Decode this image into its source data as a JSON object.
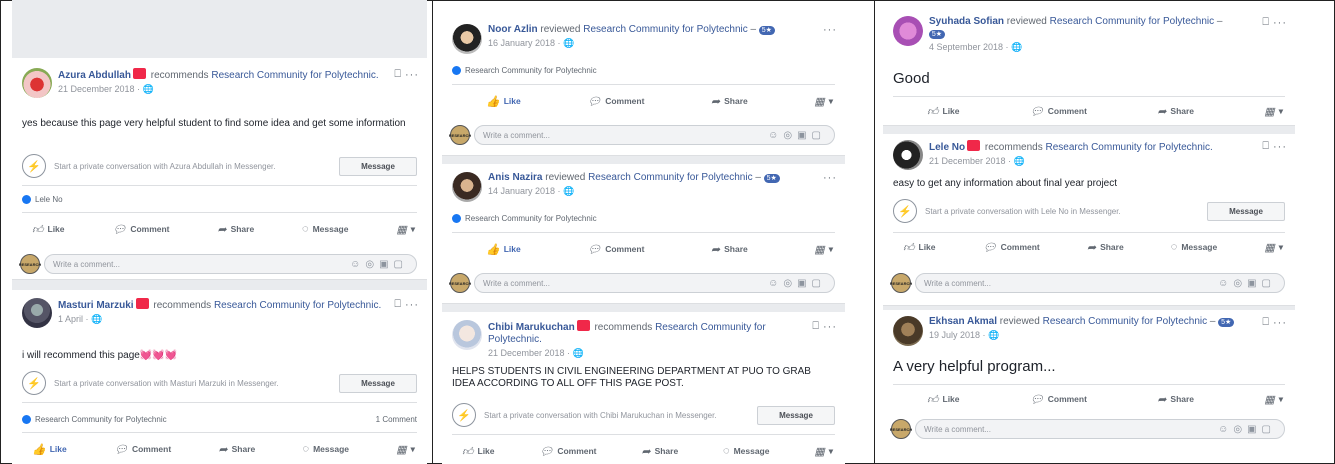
{
  "common": {
    "page_name": "Research Community for Polytechnic",
    "recommends": "recommends",
    "reviewed": "reviewed",
    "dash": "–",
    "badge": "5★",
    "like": "Like",
    "comment": "Comment",
    "share": "Share",
    "message": "Message",
    "write_comment": "Write a comment...",
    "message_button": "Message",
    "page_avatar": "RESEARCH",
    "colors": {
      "link": "#385898",
      "like_active": "#4267b2",
      "flag": "#f02849",
      "badge": "#4267b2"
    }
  },
  "posts": {
    "azura": {
      "name": "Azura Abdullah",
      "page": "Research Community for Polytechnic.",
      "date": "21 December 2018 · 🌐",
      "text": "yes because this page very helpful student to find some idea and get some information",
      "pm_text": "Start a private conversation with Azura Abdullah in Messenger.",
      "liker": "Lele No"
    },
    "masturi": {
      "name": "Masturi Marzuki",
      "page": "Research Community for Polytechnic.",
      "date": "1 April · 🌐",
      "text": "i will recommend this page💓💓💓",
      "pm_text": "Start a private conversation with Masturi Marzuki in Messenger.",
      "rec": "Research Community for Polytechnic",
      "comment_count": "1 Comment"
    },
    "noor": {
      "name": "Noor Azlin",
      "page": "Research Community for Polytechnic",
      "date": "16 January 2018 · 🌐",
      "rec": "Research Community for Polytechnic"
    },
    "anis": {
      "name": "Anis Nazira",
      "page": "Research Community for Polytechnic",
      "date": "14 January 2018 · 🌐",
      "rec": "Research Community for Polytechnic"
    },
    "chibi": {
      "name": "Chibi Marukuchan",
      "page": "Research Community for Polytechnic.",
      "date": "21 December 2018 · 🌐",
      "text": "HELPS STUDENTS IN CIVIL ENGINEERING DEPARTMENT AT PUO TO GRAB IDEA ACCORDING TO ALL OFF THIS PAGE POST.",
      "pm_text": "Start a private conversation with Chibi Marukuchan in Messenger."
    },
    "syuhada": {
      "name": "Syuhada Sofian",
      "page": "Research Community for Polytechnic",
      "date": "4 September 2018 · 🌐",
      "text": "Good"
    },
    "lele": {
      "name": "Lele No",
      "page": "Research Community for Polytechnic.",
      "date": "21 December 2018 · 🌐",
      "text": "easy to get any information about final year project",
      "pm_text": "Start a private conversation with Lele No in Messenger."
    },
    "ekhsan": {
      "name": "Ekhsan Akmal",
      "page": "Research Community for Polytechnic",
      "date": "19 July 2018 · 🌐",
      "text": "A very helpful program..."
    }
  }
}
